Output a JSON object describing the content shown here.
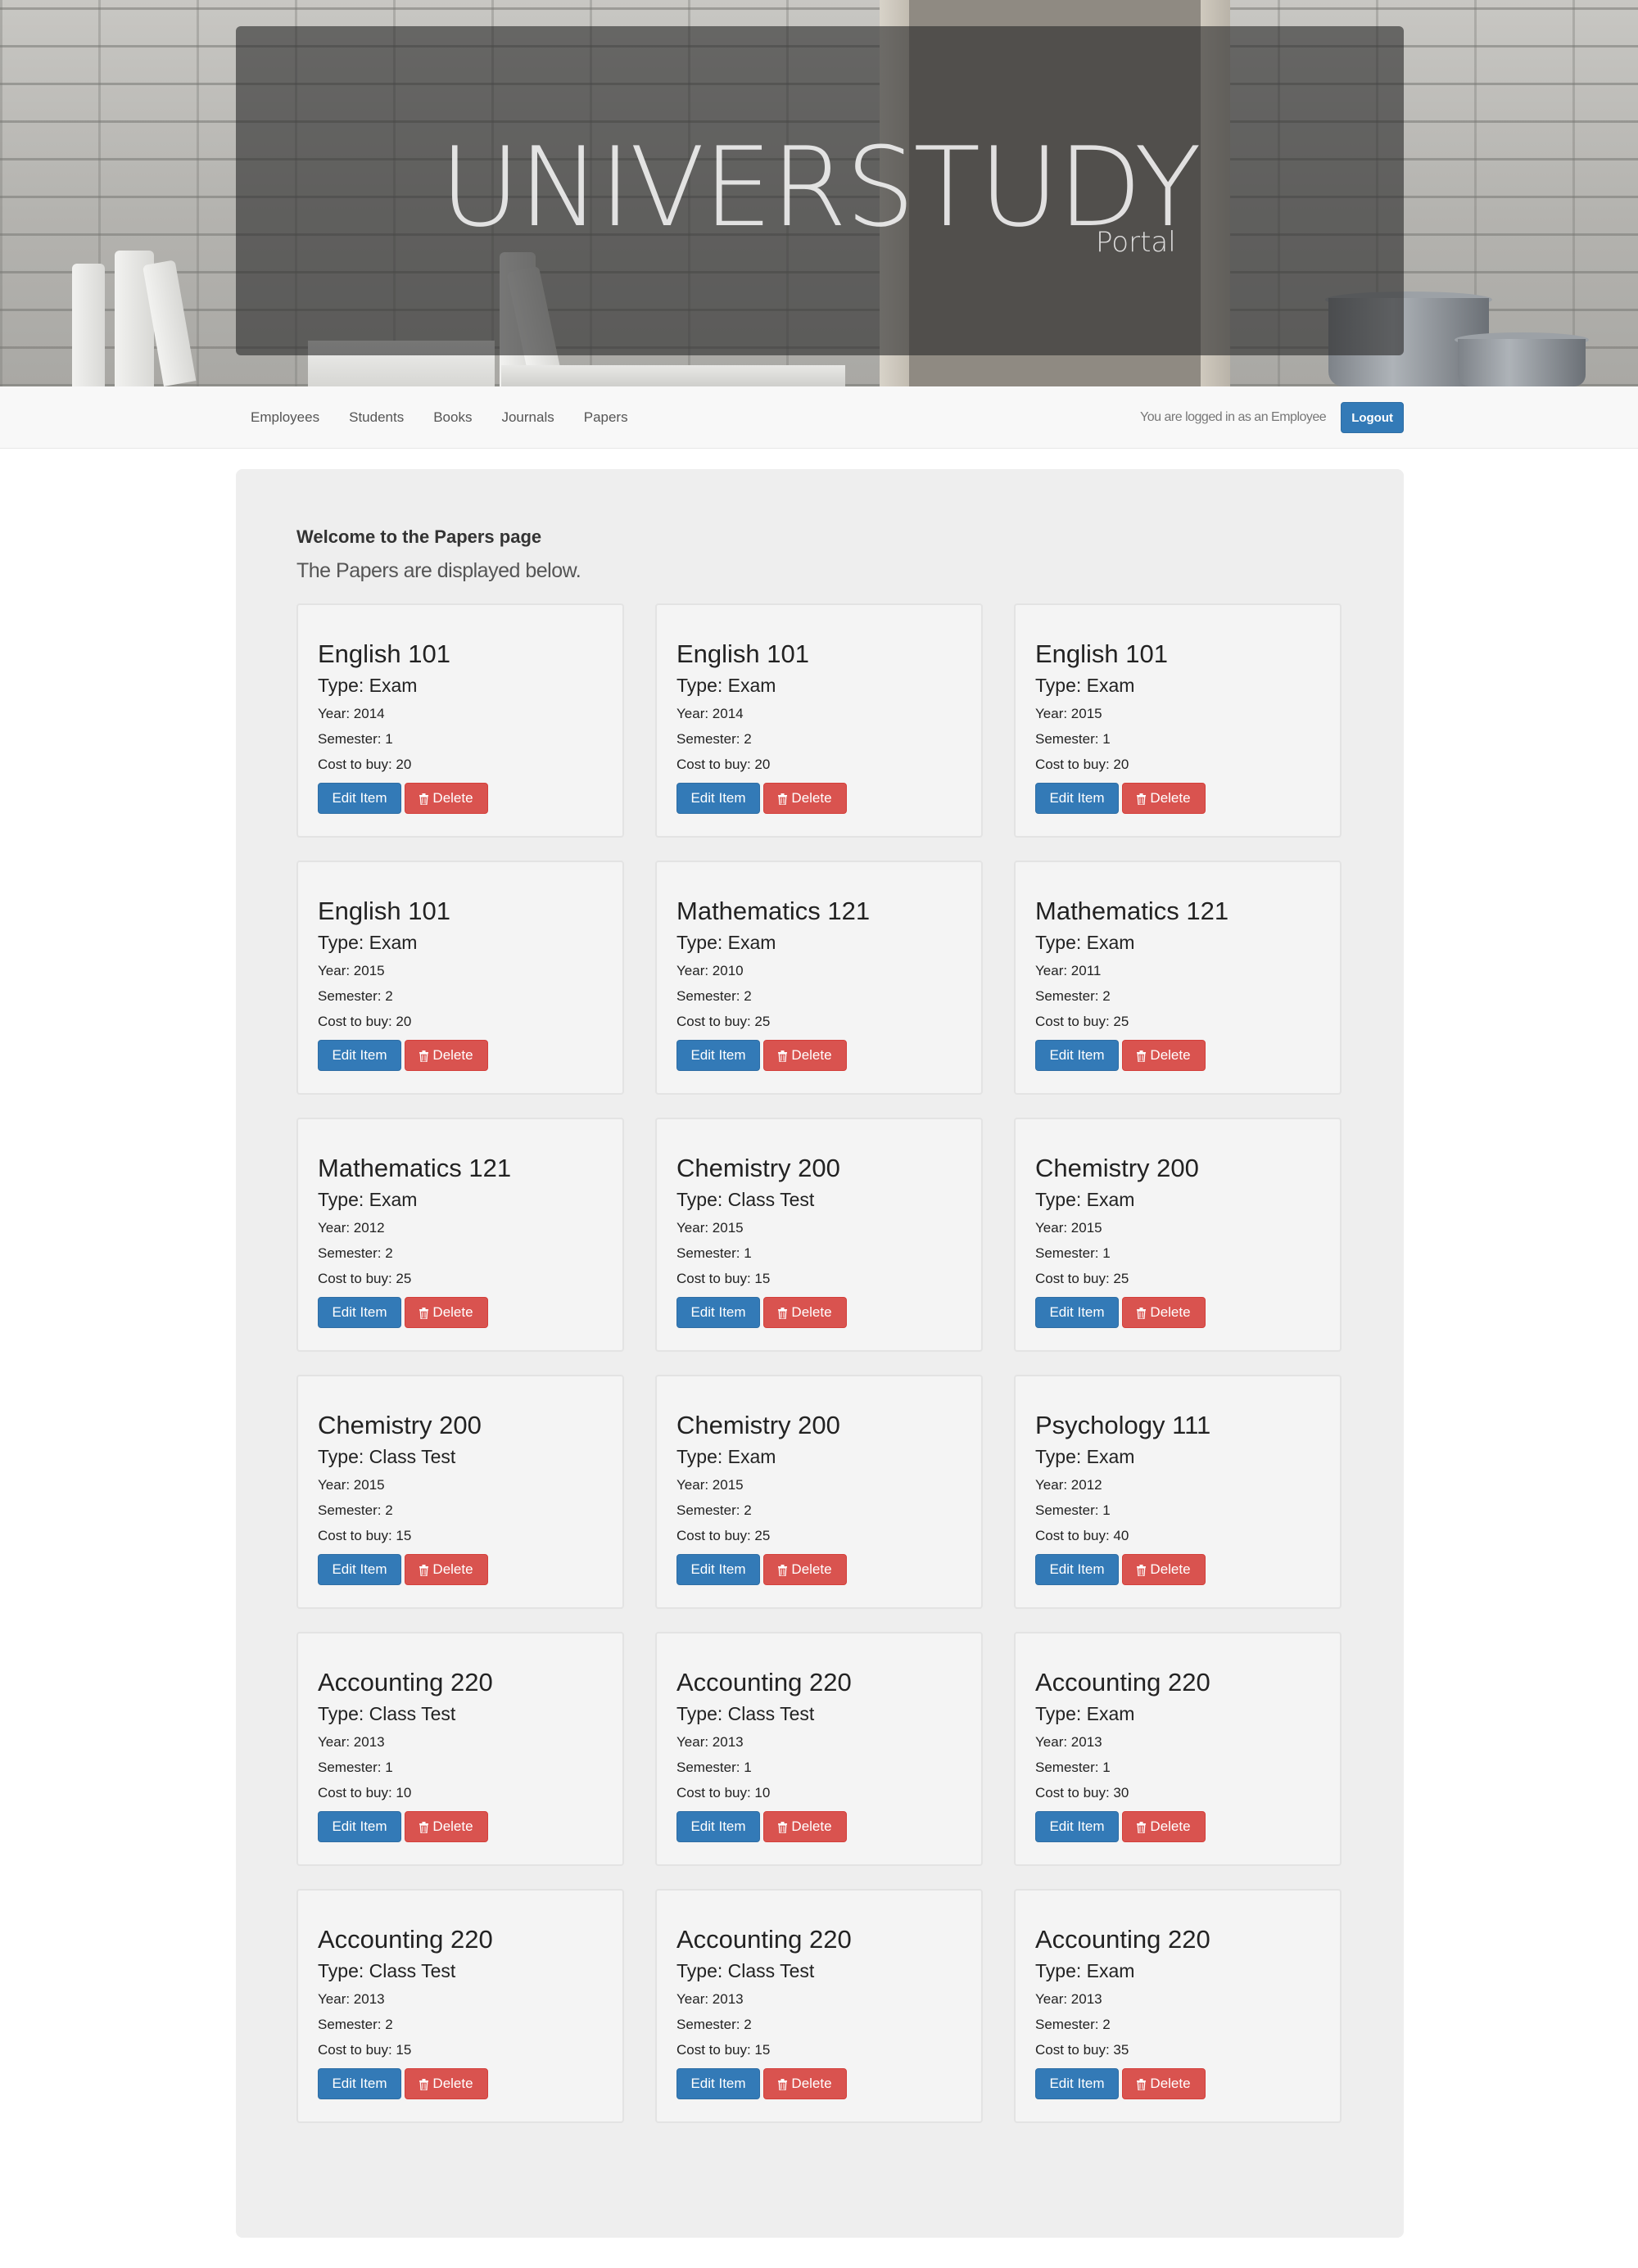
{
  "brand": {
    "title": "UNIVERSTUDY",
    "subtitle": "Portal"
  },
  "nav": {
    "links": [
      {
        "label": "Employees"
      },
      {
        "label": "Students"
      },
      {
        "label": "Books"
      },
      {
        "label": "Journals"
      },
      {
        "label": "Papers"
      }
    ],
    "login_status": "You are logged in as an Employee",
    "logout_label": "Logout"
  },
  "main": {
    "welcome": "Welcome to the Papers page",
    "lead": "The Papers are displayed below.",
    "edit_label": "Edit Item",
    "delete_label": "Delete",
    "cards": [
      {
        "title": "English 101",
        "type": "Type: Exam",
        "year": "Year: 2014",
        "semester": "Semester: 1",
        "cost": "Cost to buy: 20"
      },
      {
        "title": "English 101",
        "type": "Type: Exam",
        "year": "Year: 2014",
        "semester": "Semester: 2",
        "cost": "Cost to buy: 20"
      },
      {
        "title": "English 101",
        "type": "Type: Exam",
        "year": "Year: 2015",
        "semester": "Semester: 1",
        "cost": "Cost to buy: 20"
      },
      {
        "title": "English 101",
        "type": "Type: Exam",
        "year": "Year: 2015",
        "semester": "Semester: 2",
        "cost": "Cost to buy: 20"
      },
      {
        "title": "Mathematics 121",
        "type": "Type: Exam",
        "year": "Year: 2010",
        "semester": "Semester: 2",
        "cost": "Cost to buy: 25"
      },
      {
        "title": "Mathematics 121",
        "type": "Type: Exam",
        "year": "Year: 2011",
        "semester": "Semester: 2",
        "cost": "Cost to buy: 25"
      },
      {
        "title": "Mathematics 121",
        "type": "Type: Exam",
        "year": "Year: 2012",
        "semester": "Semester: 2",
        "cost": "Cost to buy: 25"
      },
      {
        "title": "Chemistry 200",
        "type": "Type: Class Test",
        "year": "Year: 2015",
        "semester": "Semester: 1",
        "cost": "Cost to buy: 15"
      },
      {
        "title": "Chemistry 200",
        "type": "Type: Exam",
        "year": "Year: 2015",
        "semester": "Semester: 1",
        "cost": "Cost to buy: 25"
      },
      {
        "title": "Chemistry 200",
        "type": "Type: Class Test",
        "year": "Year: 2015",
        "semester": "Semester: 2",
        "cost": "Cost to buy: 15"
      },
      {
        "title": "Chemistry 200",
        "type": "Type: Exam",
        "year": "Year: 2015",
        "semester": "Semester: 2",
        "cost": "Cost to buy: 25"
      },
      {
        "title": "Psychology 111",
        "type": "Type: Exam",
        "year": "Year: 2012",
        "semester": "Semester: 1",
        "cost": "Cost to buy: 40"
      },
      {
        "title": "Accounting 220",
        "type": "Type: Class Test",
        "year": "Year: 2013",
        "semester": "Semester: 1",
        "cost": "Cost to buy: 10"
      },
      {
        "title": "Accounting 220",
        "type": "Type: Class Test",
        "year": "Year: 2013",
        "semester": "Semester: 1",
        "cost": "Cost to buy: 10"
      },
      {
        "title": "Accounting 220",
        "type": "Type: Exam",
        "year": "Year: 2013",
        "semester": "Semester: 1",
        "cost": "Cost to buy: 30"
      },
      {
        "title": "Accounting 220",
        "type": "Type: Class Test",
        "year": "Year: 2013",
        "semester": "Semester: 2",
        "cost": "Cost to buy: 15"
      },
      {
        "title": "Accounting 220",
        "type": "Type: Class Test",
        "year": "Year: 2013",
        "semester": "Semester: 2",
        "cost": "Cost to buy: 15"
      },
      {
        "title": "Accounting 220",
        "type": "Type: Exam",
        "year": "Year: 2013",
        "semester": "Semester: 2",
        "cost": "Cost to buy: 35"
      }
    ]
  }
}
